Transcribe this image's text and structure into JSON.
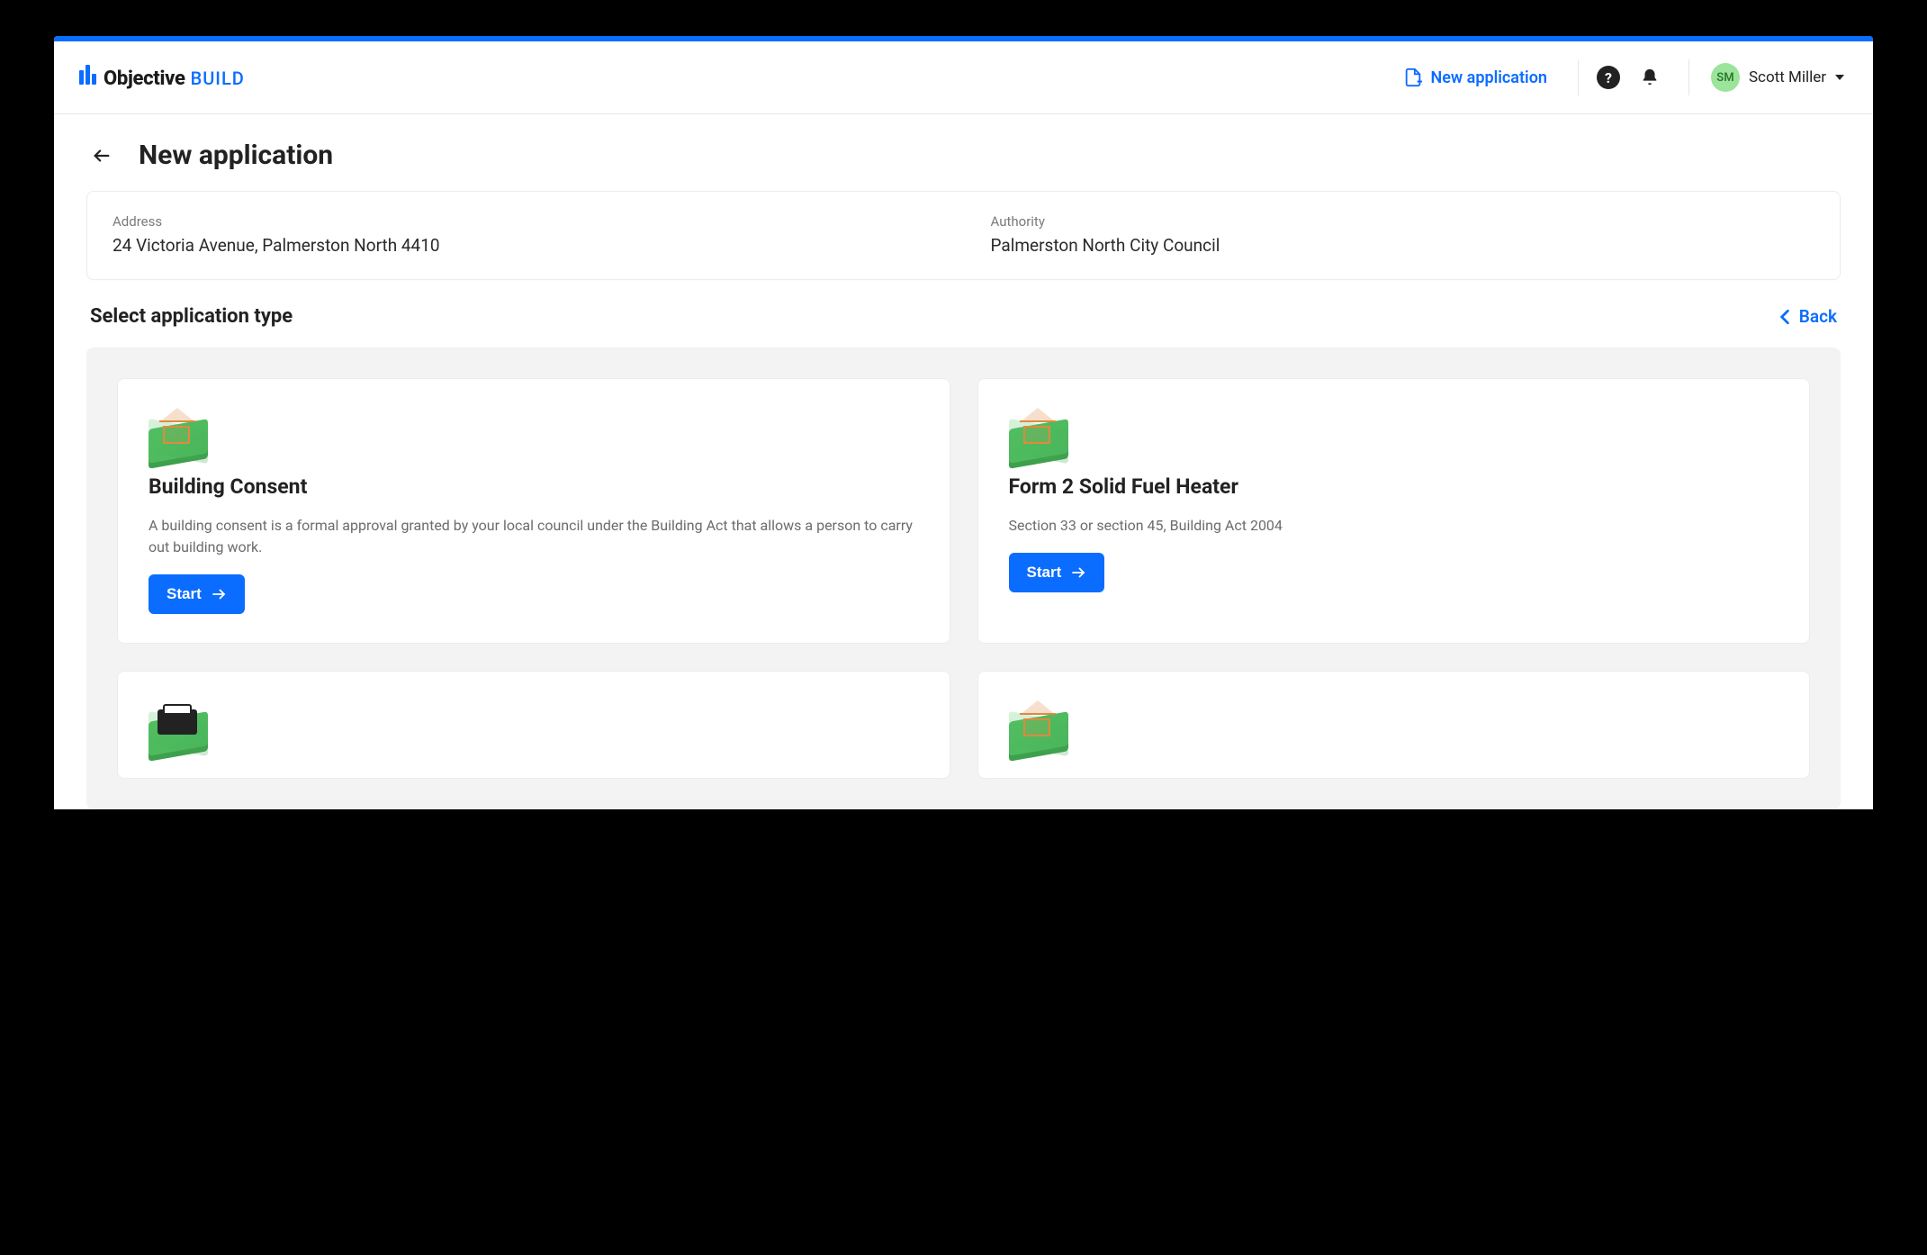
{
  "brand": {
    "main": "Objective",
    "sub": "BUILD"
  },
  "header": {
    "new_application": "New application",
    "user_initials": "SM",
    "user_name": "Scott Miller"
  },
  "page": {
    "title": "New application",
    "section_title": "Select application type",
    "back_label": "Back"
  },
  "summary": {
    "address_label": "Address",
    "address_value": "24 Victoria Avenue, Palmerston North 4410",
    "authority_label": "Authority",
    "authority_value": "Palmerston North City Council"
  },
  "cards": [
    {
      "title": "Building Consent",
      "desc": "A building consent is a formal approval granted by your local council under the Building Act that allows a person to carry out building work.",
      "cta": "Start",
      "icon": "house"
    },
    {
      "title": "Form 2 Solid Fuel Heater",
      "desc": "Section 33 or section 45, Building Act 2004",
      "cta": "Start",
      "icon": "house"
    },
    {
      "title": "",
      "desc": "",
      "cta": "",
      "icon": "board"
    },
    {
      "title": "",
      "desc": "",
      "cta": "",
      "icon": "house"
    }
  ],
  "colors": {
    "accent": "#0b6dff",
    "base_green": "#4dbb5e"
  }
}
